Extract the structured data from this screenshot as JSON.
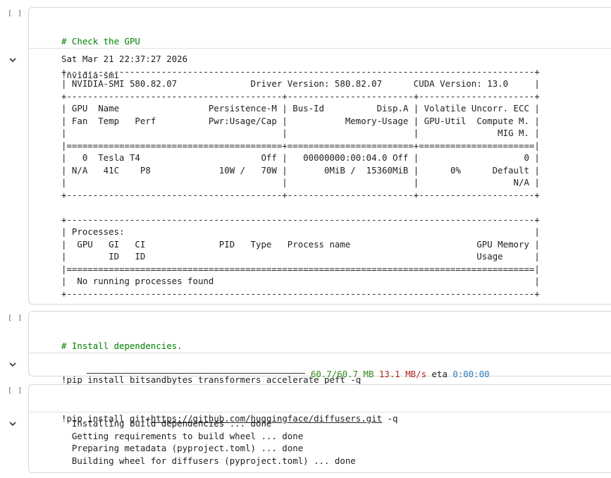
{
  "cells": [
    {
      "run_label": "[ ]",
      "code": [
        "# Check the GPU",
        "!nvidia-smi"
      ],
      "output": [
        "Sat Mar 21 22:37:27 2026",
        "+-----------------------------------------------------------------------------------------+",
        "| NVIDIA-SMI 580.82.07              Driver Version: 580.82.07      CUDA Version: 13.0     |",
        "+-----------------------------------------+------------------------+----------------------+",
        "| GPU  Name                 Persistence-M | Bus-Id          Disp.A | Volatile Uncorr. ECC |",
        "| Fan  Temp   Perf          Pwr:Usage/Cap |           Memory-Usage | GPU-Util  Compute M. |",
        "|                                         |                        |               MIG M. |",
        "|=========================================+========================+======================|",
        "|   0  Tesla T4                       Off |   00000000:00:04.0 Off |                    0 |",
        "| N/A   41C    P8             10W /   70W |       0MiB /  15360MiB |      0%      Default |",
        "|                                         |                        |                  N/A |",
        "+-----------------------------------------+------------------------+----------------------+",
        "",
        "+-----------------------------------------------------------------------------------------+",
        "| Processes:                                                                              |",
        "|  GPU   GI   CI              PID   Type   Process name                        GPU Memory |",
        "|        ID   ID                                                               Usage      |",
        "|=========================================================================================|",
        "|  No running processes found                                                             |",
        "+-----------------------------------------------------------------------------------------+"
      ]
    },
    {
      "run_label": "[ ]",
      "code_comment": "# Install dependencies.",
      "code_cmd": "!pip install bitsandbytes transformers accelerate peft -q",
      "progress": {
        "fraction": 1.0,
        "size": "60.7/60.7 MB",
        "speed": "13.1 MB/s",
        "eta_label": "eta",
        "eta": "0:00:00"
      }
    },
    {
      "run_label": "[ ]",
      "code_prefix": "!pip install git+",
      "code_link": "https://github.com/huggingface/diffusers.git",
      "code_suffix": " -q",
      "output": [
        "  Installing build dependencies ... done",
        "  Getting requirements to build wheel ... done",
        "  Preparing metadata (pyproject.toml) ... done",
        "  Building wheel for diffusers (pyproject.toml) ... done"
      ]
    }
  ]
}
